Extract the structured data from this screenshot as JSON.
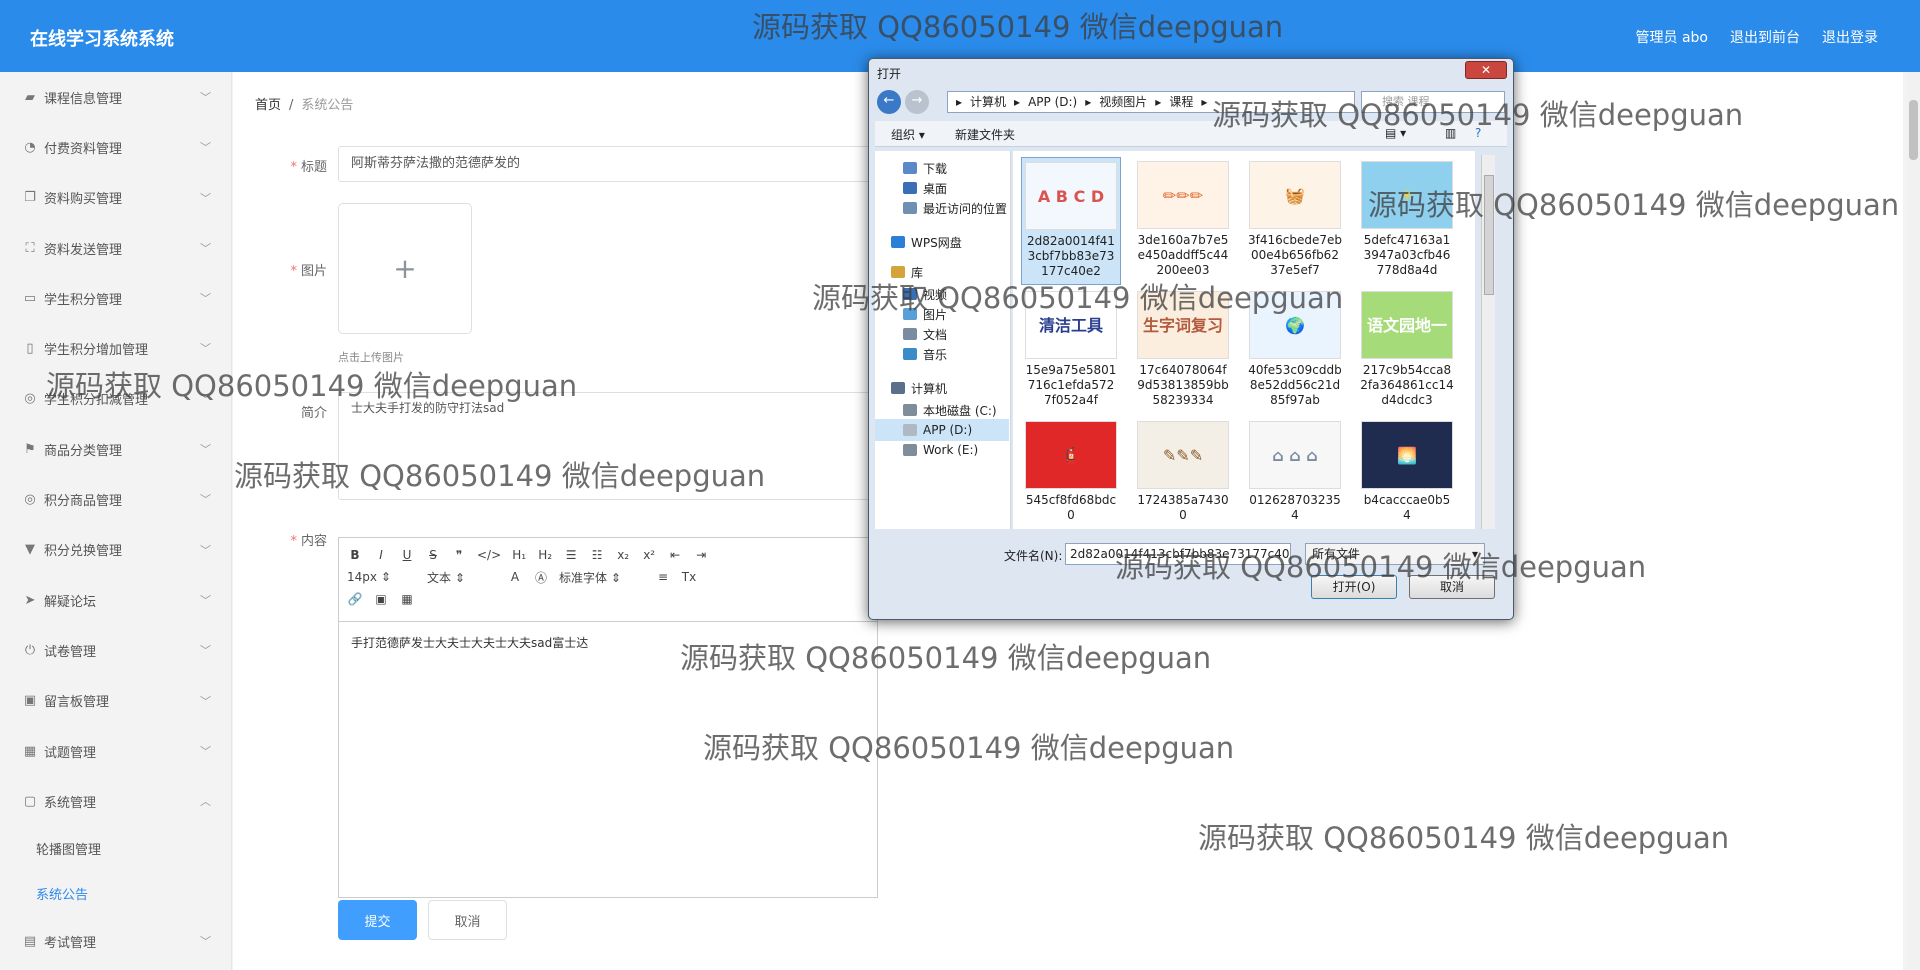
{
  "app": {
    "title": "在线学习系统系统"
  },
  "top_links": {
    "user": "管理员 abo",
    "front": "退出到前台",
    "logout": "退出登录"
  },
  "sidebar": {
    "items": [
      {
        "label": "课程信息管理",
        "icon": "book-icon"
      },
      {
        "label": "付费资料管理",
        "icon": "coin-icon"
      },
      {
        "label": "资料购买管理",
        "icon": "copy-icon"
      },
      {
        "label": "资料发送管理",
        "icon": "frame-icon"
      },
      {
        "label": "学生积分管理",
        "icon": "card-icon"
      },
      {
        "label": "学生积分增加管理",
        "icon": "phone-icon"
      },
      {
        "label": "学生积分扣减管理",
        "icon": "compass-icon"
      },
      {
        "label": "商品分类管理",
        "icon": "flag-icon"
      },
      {
        "label": "积分商品管理",
        "icon": "compass-icon"
      },
      {
        "label": "积分兑换管理",
        "icon": "cup-icon"
      },
      {
        "label": "解疑论坛",
        "icon": "send-icon"
      },
      {
        "label": "试卷管理",
        "icon": "power-icon"
      },
      {
        "label": "留言板管理",
        "icon": "clipboard-icon"
      },
      {
        "label": "试题管理",
        "icon": "grid-icon"
      },
      {
        "label": "系统管理",
        "icon": "chat-icon"
      }
    ],
    "sub_items": [
      "轮播图管理",
      "系统公告"
    ],
    "last_item": {
      "label": "考试管理",
      "icon": "printer-icon"
    }
  },
  "breadcrumb": {
    "home": "首页",
    "sep": "/",
    "current": "系统公告"
  },
  "form": {
    "title_label": "标题",
    "title_value": "阿斯蒂芬萨法撒的范德萨发的",
    "image_label": "图片",
    "upload_plus": "+",
    "upload_tip": "点击上传图片",
    "intro_label": "简介",
    "intro_value": "士大夫手打发的防守打法sad",
    "content_label": "内容",
    "editor_fontsize": "14px",
    "editor_format": "文本",
    "editor_font": "标准字体",
    "editor_body": "手打范德萨发士大夫士大夫士大夫sad富士达",
    "submit": "提交",
    "cancel": "取消"
  },
  "dialog": {
    "title": "打开",
    "close": "✕",
    "path": [
      "计算机",
      "APP (D:)",
      "视频图片",
      "课程"
    ],
    "search_placeholder": "搜索 课程",
    "organize": "组织 ▾",
    "new_folder": "新建文件夹",
    "nav": [
      "下载",
      "桌面",
      "最近访问的位置",
      "WPS网盘",
      "库",
      "视频",
      "图片",
      "文档",
      "音乐",
      "计算机",
      "本地磁盘 (C:)",
      "APP (D:)",
      "Work (E:)"
    ],
    "files": [
      {
        "name": "2d82a0014f413cbf7bb83e73177c40e2",
        "thumb": "A B C D",
        "bg": "#f3f8ff",
        "fg": "#d9534f"
      },
      {
        "name": "3de160a7b7e5e450addff5c44200ee03",
        "thumb": "✏✏✏",
        "bg": "#fff3e8",
        "fg": "#e0692e"
      },
      {
        "name": "3f416cbede7eb00e4b656fb6237e5ef7",
        "thumb": "🧺",
        "bg": "#fdf3e6",
        "fg": "#c0392b"
      },
      {
        "name": "5defc47163a13947a03cfb46778d8a4d",
        "thumb": "☀",
        "bg": "#8fd0ef",
        "fg": "#f4d03f"
      },
      {
        "name": "15e9a75e5801716c1efda5727f052a4f",
        "thumb": "清洁工具",
        "bg": "#ffffff",
        "fg": "#2a3e8f"
      },
      {
        "name": "17c64078064f9d53813859bb58239334",
        "thumb": "生字词复习",
        "bg": "#fbeede",
        "fg": "#b35b3d"
      },
      {
        "name": "40fe53c09cddb8e52dd56c21d85f97ab",
        "thumb": "🌍",
        "bg": "#eaf4ff",
        "fg": "#2d7dd2"
      },
      {
        "name": "217c9b54cca82fa364861cc14d4dcdc3",
        "thumb": "语文园地一",
        "bg": "#a6db7a",
        "fg": "#ffffff"
      },
      {
        "name": "545cf8fd68bdc0",
        "thumb": "🧯",
        "bg": "#e02828",
        "fg": "#ffffff"
      },
      {
        "name": "1724385a74300",
        "thumb": "✎✎✎",
        "bg": "#f4efe6",
        "fg": "#8b5a2b"
      },
      {
        "name": "0126287032354",
        "thumb": "⌂ ⌂ ⌂",
        "bg": "#f7f7f7",
        "fg": "#7a8ca0"
      },
      {
        "name": "b4cacccae0b54",
        "thumb": "🌅",
        "bg": "#1f2c4f",
        "fg": "#f5a14a"
      }
    ],
    "filename_label": "文件名(N):",
    "filename_value": "2d82a0014f413cbf7bb83e73177c40e2",
    "filetype": "所有文件",
    "open": "打开(O)",
    "cancel": "取消"
  },
  "watermark": "源码获取 QQ86050149 微信deepguan"
}
